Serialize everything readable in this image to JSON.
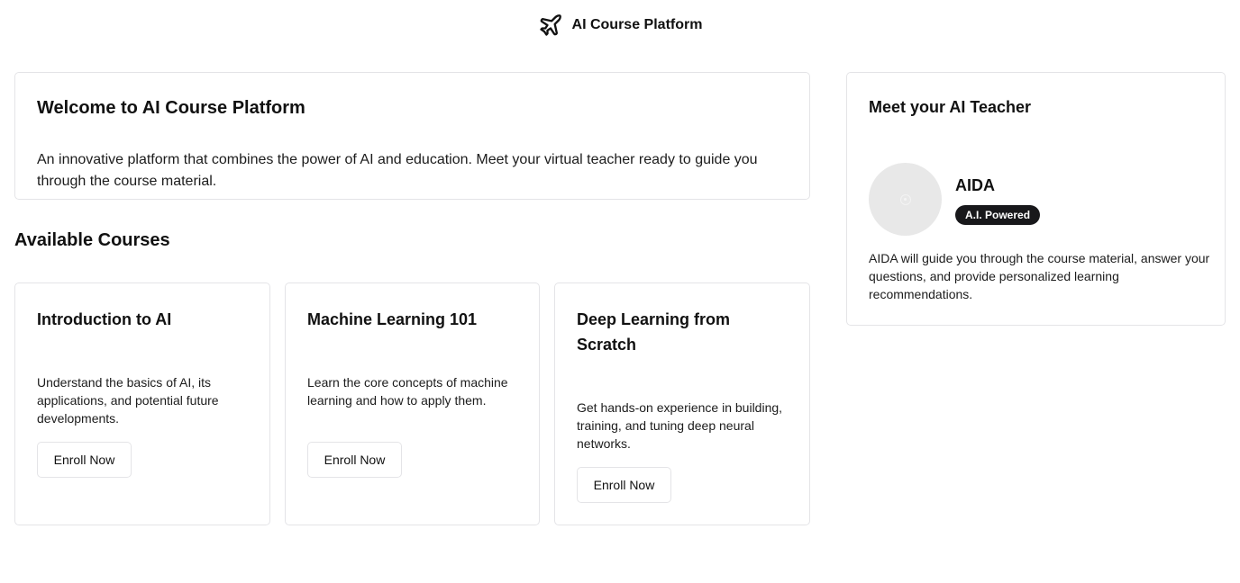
{
  "header": {
    "brand_name": "AI Course Platform",
    "logo_icon": "plane-icon"
  },
  "welcome": {
    "title": "Welcome to AI Course Platform",
    "description": "An innovative platform that combines the power of AI and education. Meet your virtual teacher ready to guide you through the course material."
  },
  "courses_section": {
    "heading": "Available Courses",
    "courses": [
      {
        "title": "Introduction to AI",
        "description": "Understand the basics of AI, its applications, and potential future developments.",
        "button_label": "Enroll Now"
      },
      {
        "title": "Machine Learning 101",
        "description": "Learn the core concepts of machine learning and how to apply them.",
        "button_label": "Enroll Now"
      },
      {
        "title": "Deep Learning from Scratch",
        "description": "Get hands-on experience in building, training, and tuning deep neural networks.",
        "button_label": "Enroll Now"
      }
    ]
  },
  "teacher": {
    "title": "Meet your AI Teacher",
    "name": "AIDA",
    "badge": "A.I. Powered",
    "description": "AIDA will guide you through the course material, answer your questions, and provide personalized learning recommendations.",
    "avatar_icon": "avatar-placeholder-icon"
  },
  "colors": {
    "badge_background": "#18181b",
    "card_border": "#e4e4e7",
    "avatar_background": "#e8e8e8"
  }
}
